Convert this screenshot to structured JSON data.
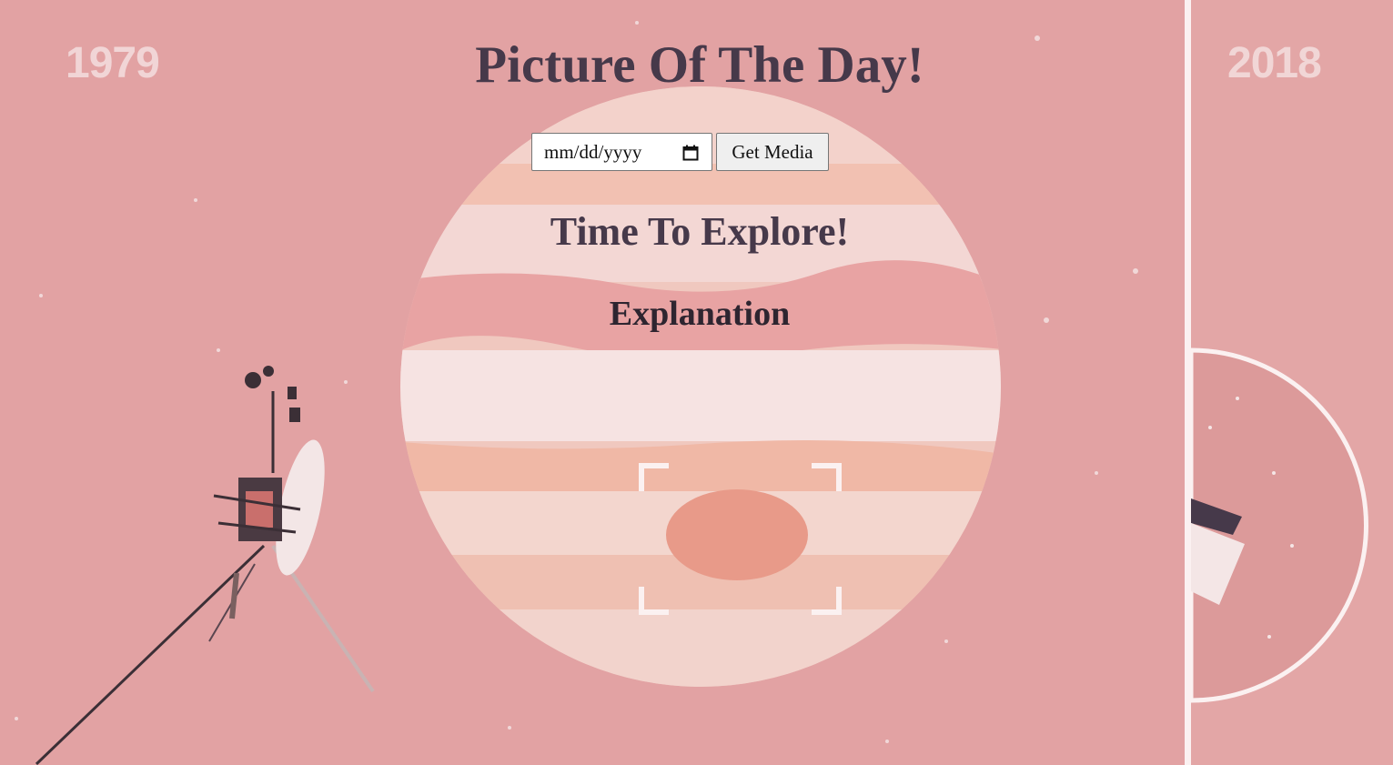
{
  "page": {
    "title": "Picture Of The Day!",
    "subtitle": "Time To Explore!",
    "explanation_heading": "Explanation"
  },
  "controls": {
    "date_placeholder": "mm/dd/yyyy",
    "get_media_label": "Get Media"
  },
  "background": {
    "year_left": "1979",
    "year_right": "2018"
  },
  "colors": {
    "background": "#e2a2a3",
    "heading": "#46394a",
    "divider": "#fbf1f1"
  }
}
